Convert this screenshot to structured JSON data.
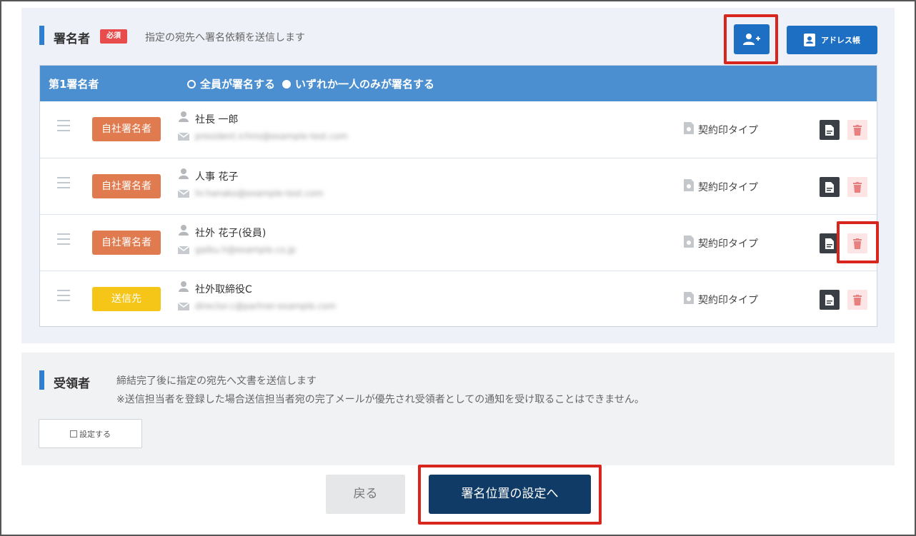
{
  "signers_section": {
    "title": "署名者",
    "required_badge": "必須",
    "description": "指定の宛先へ署名依頼を送信します",
    "add_signer_icon": "add-user-icon",
    "address_book_label": "アドレス帳",
    "table": {
      "head_label": "第1署名者",
      "option_all": "全員が署名する",
      "option_any": "いずれか一人のみが署名する"
    },
    "signers": [
      {
        "role": "自社署名者",
        "role_color": "#e07b4f",
        "name": "社長 一郎",
        "email": "president.ichiro@example-test.com",
        "seal_type": "契約印タイプ"
      },
      {
        "role": "自社署名者",
        "role_color": "#e07b4f",
        "name": "人事 花子",
        "email": "hr.hanako@example-test.com",
        "seal_type": "契約印タイプ"
      },
      {
        "role": "自社署名者",
        "role_color": "#e07b4f",
        "name": "社外 花子(役員)",
        "email": "gaibu.h@example.co.jp",
        "seal_type": "契約印タイプ"
      },
      {
        "role": "送信先",
        "role_color": "#f5c518",
        "name": "社外取締役C",
        "email": "director.c@partner-example.com",
        "seal_type": "契約印タイプ"
      }
    ]
  },
  "recipients_section": {
    "title": "受領者",
    "description": "締結完了後に指定の宛先へ文書を送信します",
    "note": "※送信担当者を登録した場合送信担当者宛の完了メールが優先され受領者としての通知を受け取ることはできません。",
    "set_label": "設定する"
  },
  "footer": {
    "back_label": "戻る",
    "next_label": "署名位置の設定へ"
  },
  "colors": {
    "accent": "#1d6fc4",
    "table_header": "#4b8fd0",
    "highlight": "#d8261e",
    "primary_dark": "#0f3b66"
  }
}
